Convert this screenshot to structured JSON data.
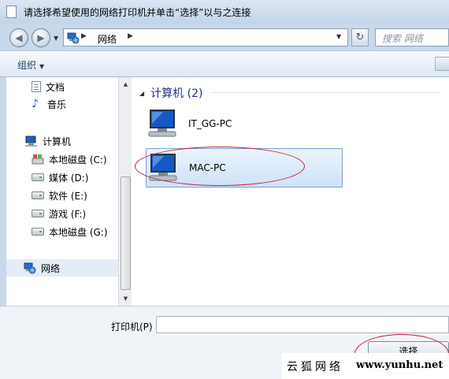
{
  "window": {
    "title": "请选择希望使用的网络打印机并单击“选择”以与之连接"
  },
  "navigation": {
    "back_glyph": "◀",
    "forward_glyph": "▶",
    "address_crumb": "网络",
    "crumb_separator": "▶",
    "refresh_glyph": "↻",
    "search_placeholder": "搜索 网络"
  },
  "toolbar": {
    "organize_label": "组织"
  },
  "sidebar": {
    "items": [
      {
        "label": "文档",
        "icon": "document-icon"
      },
      {
        "label": "音乐",
        "icon": "music-icon"
      },
      {
        "label": "计算机",
        "icon": "computer-icon"
      },
      {
        "label": "本地磁盘 (C:)",
        "icon": "system-drive-icon"
      },
      {
        "label": "媒体 (D:)",
        "icon": "drive-icon"
      },
      {
        "label": "软件 (E:)",
        "icon": "drive-icon"
      },
      {
        "label": "游戏 (F:)",
        "icon": "drive-icon"
      },
      {
        "label": "本地磁盘 (G:)",
        "icon": "drive-icon"
      },
      {
        "label": "网络",
        "icon": "network-icon"
      }
    ]
  },
  "content": {
    "group_title": "计算机 (2)",
    "computers": [
      {
        "name": "IT_GG-PC",
        "selected": false
      },
      {
        "name": "MAC-PC",
        "selected": true
      }
    ]
  },
  "bottom": {
    "printer_label": "打印机(P)",
    "printer_value": "",
    "select_button": "选择"
  },
  "watermark": {
    "text": "云狐网络",
    "url": "www.yunhu.net"
  },
  "colors": {
    "accent": "#1e3287",
    "highlight_ellipse": "#c0203c",
    "selection_border": "#7da2ce"
  }
}
